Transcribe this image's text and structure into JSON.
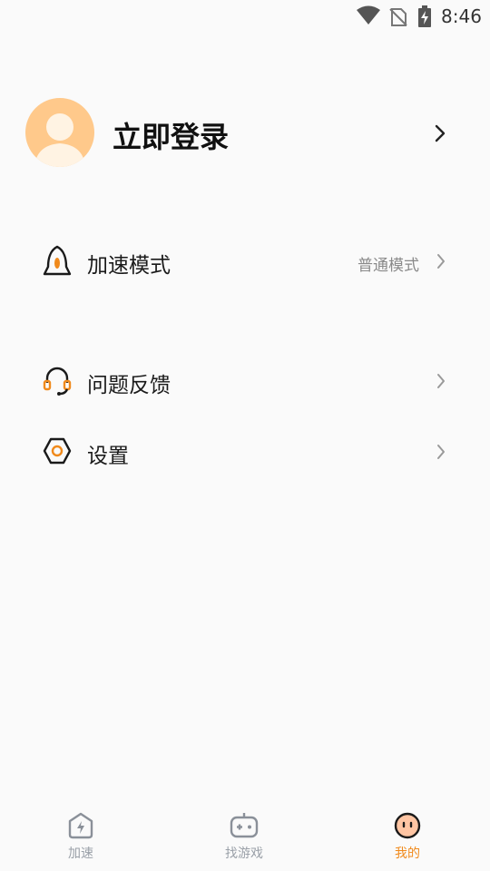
{
  "status_bar": {
    "time": "8:46"
  },
  "profile": {
    "login_label": "立即登录"
  },
  "menu": {
    "accel_mode": {
      "label": "加速模式",
      "value": "普通模式"
    },
    "feedback": {
      "label": "问题反馈"
    },
    "settings": {
      "label": "设置"
    }
  },
  "tabbar": {
    "items": [
      {
        "label": "加速"
      },
      {
        "label": "找游戏"
      },
      {
        "label": "我的"
      }
    ],
    "active_color": "#f08a1c",
    "inactive_color": "#9aa0a8"
  },
  "colors": {
    "accent": "#f08a1c",
    "avatar_bg": "#ffc98b"
  }
}
